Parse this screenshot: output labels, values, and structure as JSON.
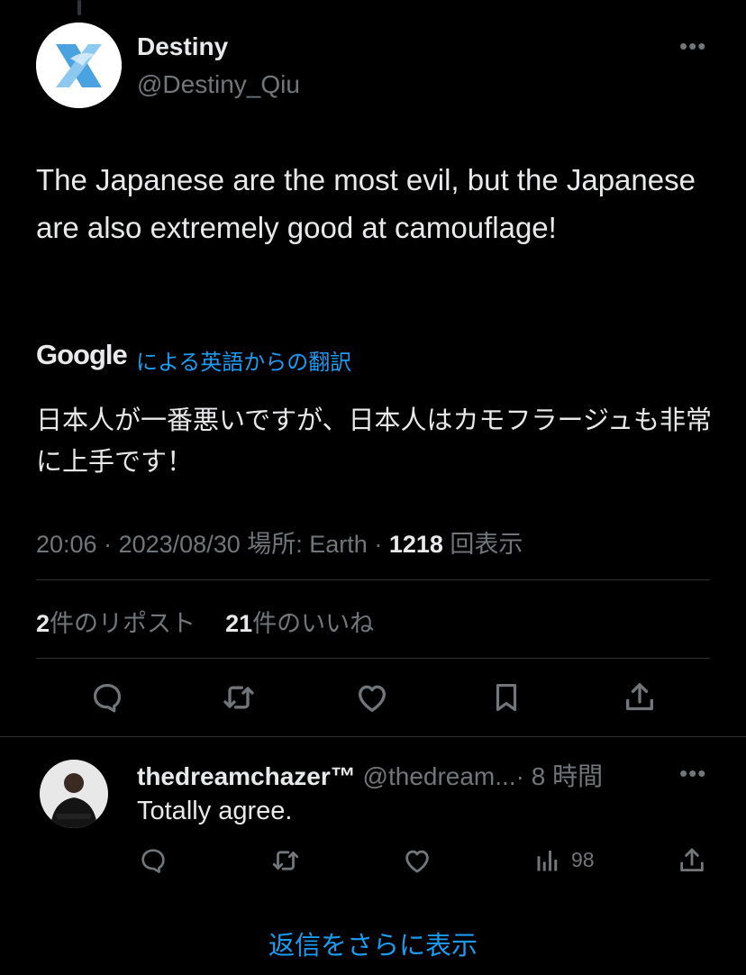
{
  "tweet": {
    "author_name": "Destiny",
    "author_handle": "@Destiny_Qiu",
    "more_label": "•••",
    "text": "The Japanese are the most evil, but the Japanese are also extremely good at camouflage!",
    "translation": {
      "provider": "Google",
      "label": "による英語からの翻訳",
      "text": "日本人が一番悪いですが、日本人はカモフラージュも非常に上手です！"
    },
    "time": "20:06",
    "date": "2023/08/30",
    "location_label": "場所: Earth",
    "views_count": "1218",
    "views_label": "回表示",
    "reposts_count": "2",
    "reposts_label": "件のリポスト",
    "likes_count": "21",
    "likes_label": "件のいいね",
    "avatar_icon": "x-bird-logo-icon"
  },
  "reply": {
    "author_name": "thedreamchazer™",
    "author_handle": "@thedream...",
    "time": "· 8 時間",
    "more_label": "•••",
    "text": "Totally agree.",
    "views": "98"
  },
  "show_more_replies": "返信をさらに表示",
  "colors": {
    "background": "#000000",
    "primary_text": "#e7e9ea",
    "secondary_text": "#71767b",
    "accent": "#1d9bf0",
    "divider": "#2f3336"
  }
}
